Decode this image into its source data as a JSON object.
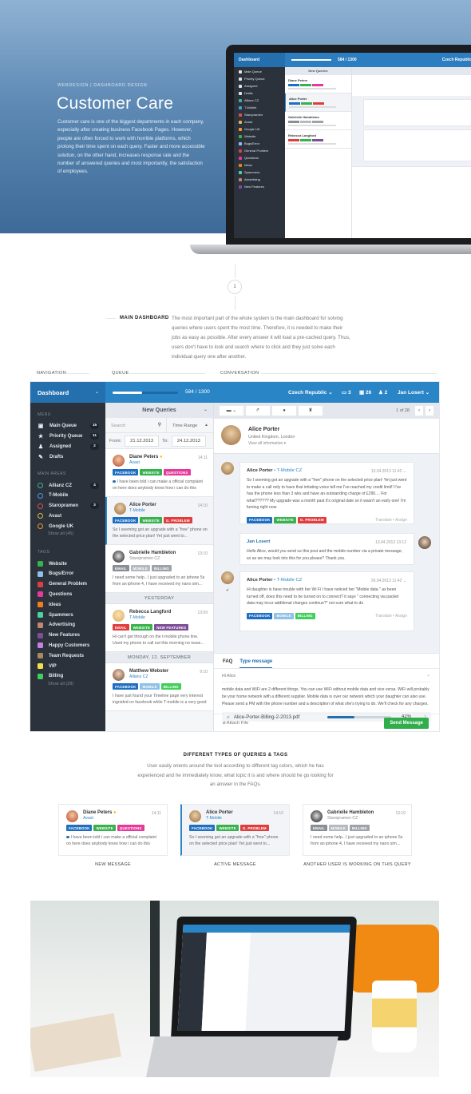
{
  "hero": {
    "eyebrow": "WEBDESIGN  |  DASHBOARD DESIGN",
    "title": "Customer Care",
    "description": "Customer care is one of the biggest departments in each company, especially after creating business Facebook Pages. However, people are often forced to work with horrible platforms, which prolong their time spent on each query. Faster and more accessible solution, on the other hand, increases response rate and the number of answered queries and most importantly, the satisfaction of employees."
  },
  "step_number": "1",
  "main_dashboard": {
    "title": "MAIN DASHBOARD",
    "description": "The most important part of the whole system is the main dashboard for solving queries where users spent the most time. Therefore, it is needed to make their jobs as easy as possible. After every answer it will load a pre-cached query. Thus, users don't have to look and search where to click and they just solve each individual query one after another."
  },
  "columns": {
    "navigation": "NAVIGATION",
    "queue": "QUEUE",
    "conversation": "CONVERSATION"
  },
  "topbar": {
    "brand": "Dashboard",
    "progress_fraction": 0.449,
    "count": "584 / 1300",
    "country": "Czech Republic",
    "messages_count": "3",
    "inbox_count": "26",
    "users_count": "2",
    "user": "Jan Losert"
  },
  "sidebar": {
    "menu_heading": "MENU",
    "menu": [
      {
        "label": "Main Queue",
        "icon": "inbox-icon",
        "glyph": "▣",
        "badge": "15"
      },
      {
        "label": "Priority Queue",
        "icon": "star-icon",
        "glyph": "★",
        "badge": "11"
      },
      {
        "label": "Assigned",
        "icon": "user-icon",
        "glyph": "♟",
        "badge": "2"
      },
      {
        "label": "Drafts",
        "icon": "edit-icon",
        "glyph": "✎",
        "badge": ""
      }
    ],
    "areas_heading": "MAIN AREAS",
    "areas": [
      {
        "label": "Allianz CZ",
        "color": "#3bb39a",
        "badge": "4"
      },
      {
        "label": "T-Mobile",
        "color": "#4a9be0",
        "badge": ""
      },
      {
        "label": "Staropramen",
        "color": "#e04b57",
        "badge": "3"
      },
      {
        "label": "Avast",
        "color": "#e0b64a",
        "badge": ""
      },
      {
        "label": "Google UK",
        "color": "#f0952e",
        "badge": ""
      }
    ],
    "areas_more": "Show all (45)",
    "tags_heading": "TAGS",
    "tags": [
      {
        "label": "Website",
        "color": "#37b24d"
      },
      {
        "label": "Bugs/Error",
        "color": "#8fc1e8"
      },
      {
        "label": "General Problem",
        "color": "#e03e3e"
      },
      {
        "label": "Questions",
        "color": "#e6399b"
      },
      {
        "label": "Ideas",
        "color": "#f07f1b"
      },
      {
        "label": "Spammers",
        "color": "#4fd19a"
      },
      {
        "label": "Advertising",
        "color": "#c4876b"
      },
      {
        "label": "New Features",
        "color": "#7e4f96"
      },
      {
        "label": "Happy Customers",
        "color": "#c77fe3"
      },
      {
        "label": "Team Requests",
        "color": "#a88a5c"
      },
      {
        "label": "VIP",
        "color": "#f2e04a"
      },
      {
        "label": "Billing",
        "color": "#3fcf5b"
      }
    ],
    "tags_more": "Show all (28)"
  },
  "queue": {
    "title": "New Queries",
    "search_placeholder": "Search",
    "time_range": "Time Range",
    "from_label": "From:",
    "from": "21.12.2013",
    "to_label": "To:",
    "to": "24.12.2013",
    "items": [
      {
        "name": "Diane Peters",
        "org": "Avast",
        "time": "14:11",
        "star": true,
        "tags": [
          [
            "FACEBOOK",
            "#1e6fc2"
          ],
          [
            "WEBSITE",
            "#37b24d"
          ],
          [
            "QUESTIONS",
            "#e6399b"
          ]
        ],
        "msg": "I have been told i can make a official complaint on here does anybody know how i can do this",
        "unread": true
      },
      {
        "name": "Alice Porter",
        "org": "T-Mobile",
        "time": "14:10",
        "active": true,
        "tags": [
          [
            "FACEBOOK",
            "#1e6fc2"
          ],
          [
            "WEBSITE",
            "#37b24d"
          ],
          [
            "G. PROBLEM",
            "#e03e3e"
          ]
        ],
        "msg": "So I seeming got an upgrade with a \"free\" phone on the selected price plan! Yet just went to..."
      },
      {
        "name": "Gabrielle Hambleton",
        "org": "Staropramen CZ",
        "time": "13:10",
        "grey": true,
        "tags": [
          [
            "EMAIL",
            "#8a8f96"
          ],
          [
            "MOBILE",
            "#b5bac0"
          ],
          [
            "BILLING",
            "#9ea3aa"
          ]
        ],
        "msg": "I need some help.. I just upgraded to an iphone 5s from an iphone 4, I have received my nano sim..."
      },
      {
        "day": "YESTERDAY"
      },
      {
        "name": "Rebecca Langford",
        "org": "T-Mobile",
        "time": "13:09",
        "tags": [
          [
            "EMAIL",
            "#e03e3e"
          ],
          [
            "WEBSITE",
            "#37b24d"
          ],
          [
            "NEW FEATURES",
            "#7e4f96"
          ]
        ],
        "msg": "Hi can't get through on the t-mobile phone line. Used my phone to call out this morning no issue..."
      },
      {
        "day": "MONDAY, 12. SEPTEMBER"
      },
      {
        "name": "Matthew Webster",
        "org": "Allianz CZ",
        "time": "9:10",
        "tags": [
          [
            "FACEBOOK",
            "#1e6fc2"
          ],
          [
            "MOBILE",
            "#8fc1e8"
          ],
          [
            "BILLING",
            "#3fcf5b"
          ]
        ],
        "msg": "I have just found your Timeline page very interest ingnided on facebook while T-mobile is a very good"
      }
    ]
  },
  "conversation": {
    "pager": "1 of 28",
    "customer_name": "Alice Porter",
    "customer_location": "United Kingdom, London",
    "view_info": "View all information ▾",
    "messages": [
      {
        "author": "Alice Porter",
        "org": "T-Mobile CZ",
        "time": "13.04.2013 11:42",
        "body": "So I seeming got an upgrade with a \"free\" phone on the selected price plan! Yet just went to make a call only to have that irritating voice tell me I've reached my credit limit!! I've has the phone less than 3 wks and have an outstanding charge of £290.... For what?????? My upgrade was a month past it's original date so it wasn't an early one! I'm fuming right now",
        "tags": [
          [
            "FACEBOOK",
            "#1e6fc2"
          ],
          [
            "WEBSITE",
            "#37b24d"
          ],
          [
            "G. PROBLEM",
            "#e03e3e"
          ]
        ],
        "actions": "Translate  •  Assign"
      },
      {
        "author": "Jan Losert",
        "time": "13.04.2013 13:12",
        "body": "Hello Alice, would you send us this post and the mobile number via a private message, so as we may look into this for you please? Thank you."
      },
      {
        "author": "Alice Porter",
        "org": "T-Mobile CZ",
        "time": "26.04.2013 11:42",
        "body": "Hi daughter is have trouble with her Wi Fi I have noticed her \"Mobile data \" as been turned off, does this need to be turned on to connect? it says \" connecting via packet data may incur additional charges continue?\" not sure what to do",
        "tags": [
          [
            "FACEBOOK",
            "#1e6fc2"
          ],
          [
            "MOBILE",
            "#8fc1e8"
          ],
          [
            "BILLING",
            "#3fcf5b"
          ]
        ],
        "actions": "Translate  •  Assign"
      }
    ],
    "reply": {
      "tab_faq": "FAQ",
      "tab_type": "Type message",
      "greeting": "Hi Alice",
      "text": "mobile data and WiFi are 2 different things. You can use WiFi without mobile data and vice versa. WiFi will probably be your home network with a different supplier. Mobile data is over our network which your daughter can also use. Please send a PM with the phone number and a description of what she's trying to do. We'll check for any charges.",
      "attachment": "Alice-Porter-Billing-2-2013.pdf",
      "upload_progress": 0.42,
      "upload_percent": "42%",
      "attach_label": "Attach File",
      "send_label": "Send Message"
    }
  },
  "types": {
    "title": "DIFFERENT TYPES OF QUERIES & TAGS",
    "description": "User easily orients around the tool according to different tag colors, which he has experienced and he immediately know, what topic it is and where should he go looking for an answer in the FAQs.",
    "labels": [
      "NEW MESSAGE",
      "ACTIVE MESSAGE",
      "ANOTHER USER IS WORKING ON THIS QUERY"
    ]
  },
  "hero_screen": {
    "brand": "Dashboard",
    "count": "584 / 1300",
    "queue_title": "New Queries",
    "country": "Czech Republic"
  }
}
